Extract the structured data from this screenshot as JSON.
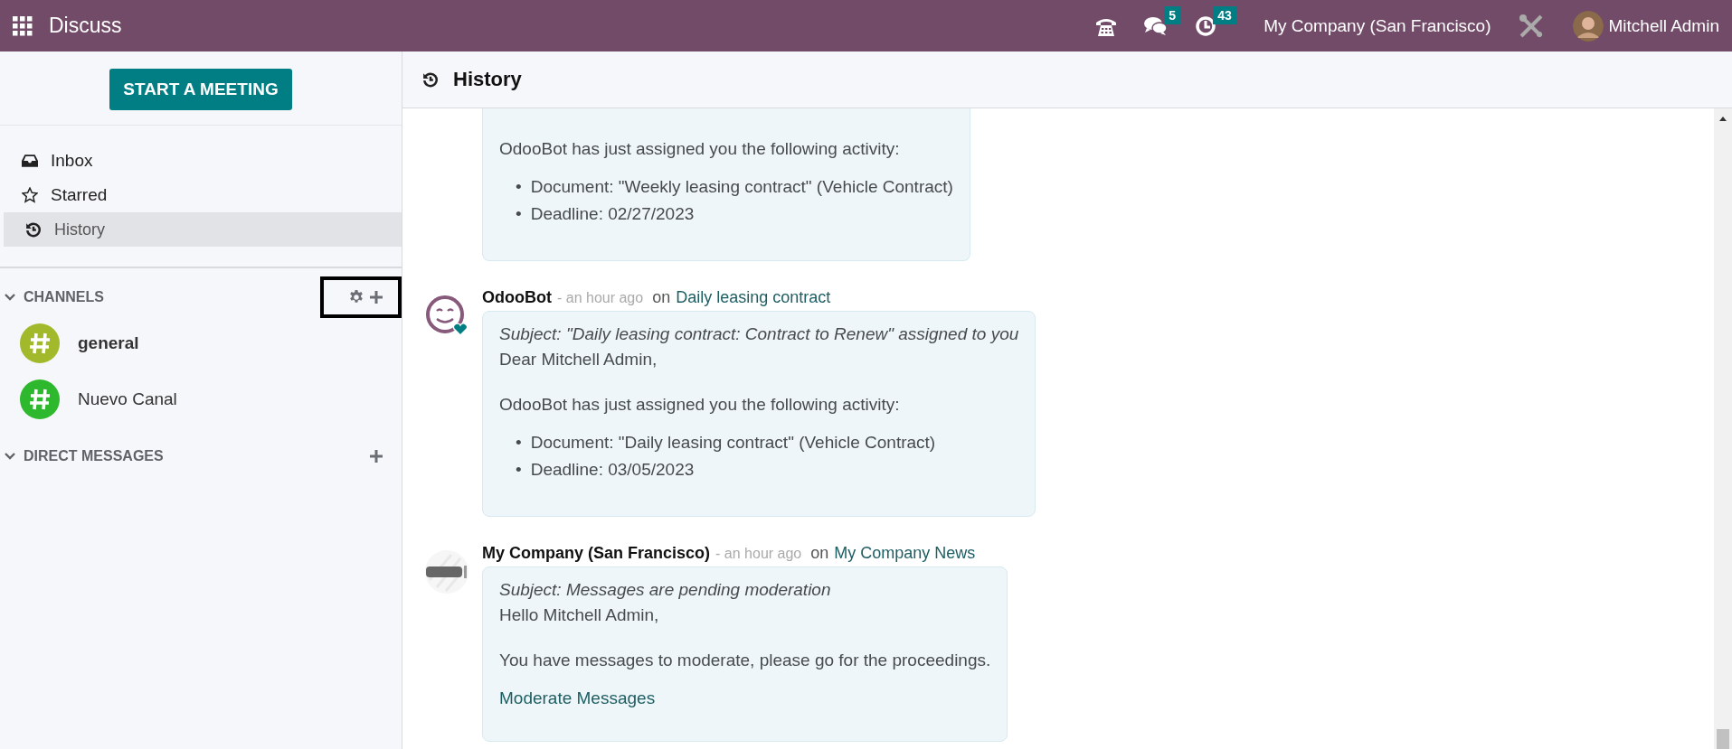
{
  "navbar": {
    "app_title": "Discuss",
    "messages_badge": "5",
    "activities_badge": "43",
    "company": "My Company (San Francisco)",
    "user": "Mitchell Admin"
  },
  "sidebar": {
    "start_button": "START A MEETING",
    "mailboxes": [
      {
        "label": "Inbox",
        "kind": "inbox",
        "selected": false
      },
      {
        "label": "Starred",
        "kind": "starred",
        "selected": false
      },
      {
        "label": "History",
        "kind": "history",
        "selected": true
      }
    ],
    "sections": [
      {
        "title": "CHANNELS",
        "expanded": true,
        "settings": true,
        "highlighted": true,
        "items": [
          {
            "name": "general",
            "color": "#a1b92b",
            "unread": true
          },
          {
            "name": "Nuevo Canal",
            "color": "#2eb82e",
            "unread": false
          }
        ]
      },
      {
        "title": "DIRECT MESSAGES",
        "expanded": true,
        "settings": false,
        "highlighted": false
      }
    ]
  },
  "thread": {
    "title": "History",
    "messages": [
      {
        "blocks": [
          {
            "kind": "text",
            "text": "OdooBot has just assigned you the following activity:"
          },
          {
            "kind": "list",
            "items": [
              {
                "marker": "•",
                "text": "Document: \"Weekly leasing contract\" (Vehicle Contract)"
              },
              {
                "marker": "•",
                "text": "Deadline: 02/27/2023"
              }
            ]
          }
        ]
      },
      {
        "author": "OdooBot",
        "avatar": {
          "kind": "bot"
        },
        "time": "- an hour ago",
        "on": "on",
        "record": "Daily leasing contract",
        "blocks": [
          {
            "kind": "subject",
            "text": "Subject: \"Daily leasing contract: Contract to Renew\" assigned to you"
          },
          {
            "kind": "greeting",
            "text": "Dear Mitchell Admin,"
          },
          {
            "kind": "text",
            "text": "OdooBot has just assigned you the following activity:"
          },
          {
            "kind": "list",
            "items": [
              {
                "marker": "•",
                "text": "Document: \"Daily leasing contract\" (Vehicle Contract)"
              },
              {
                "marker": "•",
                "text": "Deadline: 03/05/2023"
              }
            ]
          }
        ]
      },
      {
        "author": "My Company (San Francisco)",
        "avatar": {
          "kind": "company"
        },
        "time": "- an hour ago",
        "on": "on",
        "record": "My Company News",
        "blocks": [
          {
            "kind": "subject",
            "text": "Subject: Messages are pending moderation"
          },
          {
            "kind": "greeting",
            "text": "Hello Mitchell Admin,"
          },
          {
            "kind": "text",
            "text": "You have messages to moderate, please go for the proceedings."
          },
          {
            "kind": "link",
            "text": "Moderate Messages"
          }
        ]
      }
    ]
  }
}
